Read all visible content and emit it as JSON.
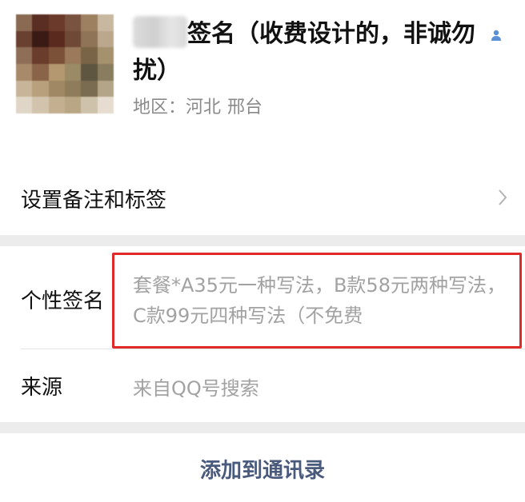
{
  "profile": {
    "nickname": "签名（收费设计的，非诚勿扰）",
    "region_label": "地区：",
    "region_province": "河北",
    "region_city": "邢台",
    "verified_icon": "person-icon"
  },
  "remark": {
    "label": "设置备注和标签",
    "chevron_icon": "chevron-right-icon"
  },
  "details": {
    "signature_label": "个性签名",
    "signature_value": "套餐*A35元一种写法，B款58元两种写法，C款99元四种写法（不免费",
    "source_label": "来源",
    "source_value": "来自QQ号搜索"
  },
  "actions": {
    "add_contact": "添加到通讯录"
  },
  "colors": {
    "highlight": "#e02a2a",
    "link": "#4a5a7c",
    "secondary_text": "#a2a2a2",
    "icon_blue": "#5b8fd6"
  }
}
